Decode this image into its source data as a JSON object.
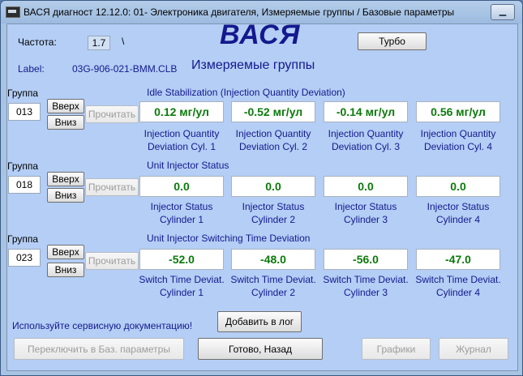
{
  "window": {
    "title": "ВАСЯ диагност 12.12.0: 01- Электроника двигателя,  Измеряемые группы / Базовые параметры",
    "minimize_glyph": "▁"
  },
  "header": {
    "freq_label": "Частота:",
    "freq_value": "1.7",
    "freq_indicator": "\\",
    "logo": "ВАСЯ",
    "turbo_label": "Турбо",
    "label_caption": "Label:",
    "label_value": "03G-906-021-BMM.CLB",
    "screen_title": "Измеряемые группы"
  },
  "groups": [
    {
      "caption": "Группа",
      "number": "013",
      "up_label": "Вверх",
      "down_label": "Вниз",
      "read_label": "Прочитать",
      "section_title": "Idle Stabilization (Injection Quantity Deviation)",
      "values": [
        "0.12 мг/ул",
        "-0.52 мг/ул",
        "-0.14 мг/ул",
        "0.56 мг/ул"
      ],
      "captions": [
        [
          "Injection Quantity",
          "Deviation Cyl. 1"
        ],
        [
          "Injection Quantity",
          "Deviation Cyl. 2"
        ],
        [
          "Injection Quantity",
          "Deviation Cyl. 3"
        ],
        [
          "Injection Quantity",
          "Deviation Cyl. 4"
        ]
      ]
    },
    {
      "caption": "Группа",
      "number": "018",
      "up_label": "Вверх",
      "down_label": "Вниз",
      "read_label": "Прочитать",
      "section_title": "Unit Injector Status",
      "values": [
        "0.0",
        "0.0",
        "0.0",
        "0.0"
      ],
      "captions": [
        [
          "Injector Status",
          "Cylinder 1"
        ],
        [
          "Injector Status",
          "Cylinder 2"
        ],
        [
          "Injector Status",
          "Cylinder 3"
        ],
        [
          "Injector Status",
          "Cylinder 4"
        ]
      ]
    },
    {
      "caption": "Группа",
      "number": "023",
      "up_label": "Вверх",
      "down_label": "Вниз",
      "read_label": "Прочитать",
      "section_title": "Unit Injector Switching Time Deviation",
      "values": [
        "-52.0",
        "-48.0",
        "-56.0",
        "-47.0"
      ],
      "captions": [
        [
          "Switch Time Deviat.",
          "Cylinder 1"
        ],
        [
          "Switch Time Deviat.",
          "Cylinder 2"
        ],
        [
          "Switch Time Deviat.",
          "Cylinder 3"
        ],
        [
          "Switch Time Deviat.",
          "Cylinder 4"
        ]
      ]
    }
  ],
  "footer": {
    "hint": "Используйте сервисную документацию!",
    "add_log_label": "Добавить в лог",
    "switch_basic_label": "Переключить в Баз. параметры",
    "done_back_label": "Готово, Назад",
    "graphs_label": "Графики",
    "journal_label": "Журнал"
  },
  "colors": {
    "client_bg": "#b4cef5",
    "accent_blue": "#14198e",
    "value_green": "#0b7a0b"
  }
}
